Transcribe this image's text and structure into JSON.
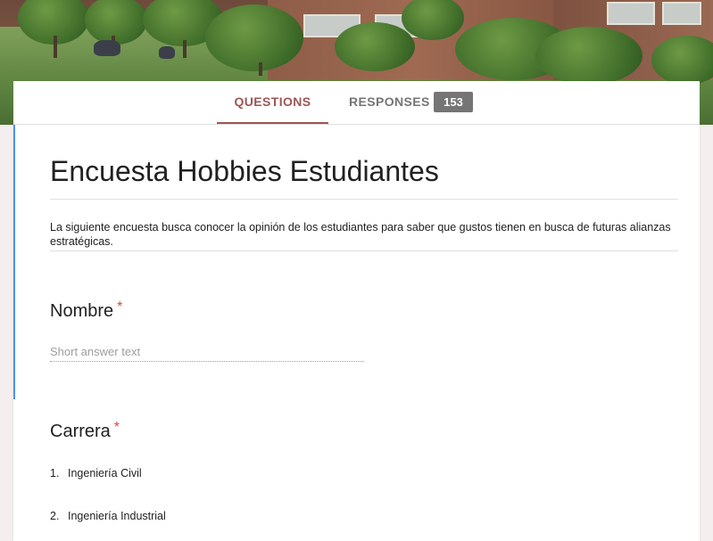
{
  "tabs": {
    "questions": "QUESTIONS",
    "responses": "RESPONSES",
    "response_count": "153",
    "active": "questions",
    "accent_color": "#9c5655"
  },
  "form": {
    "title": "Encuesta Hobbies Estudiantes",
    "description": "La siguiente encuesta busca conocer la opinión de los estudiantes para saber que gustos tienen en busca de futuras alianzas estratégicas.",
    "focus_color": "#4d90fe",
    "required_color": "#db4437"
  },
  "questions": [
    {
      "title": "Nombre",
      "required_mark": "*",
      "type": "short_answer",
      "placeholder": "Short answer text"
    },
    {
      "title": "Carrera",
      "required_mark": "*",
      "type": "list",
      "options": [
        {
          "number": "1.",
          "label": "Ingeniería Civil"
        },
        {
          "number": "2.",
          "label": "Ingeniería Industrial"
        }
      ]
    }
  ],
  "banner": {
    "image": "campus-photo"
  }
}
